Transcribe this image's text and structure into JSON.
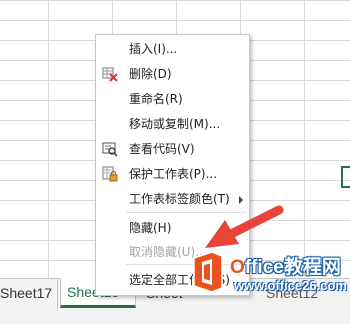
{
  "sheet_tabs": [
    {
      "label": "Sheet17",
      "active": false
    },
    {
      "label": "Sheet13",
      "active": true
    },
    {
      "label": "Sheet",
      "active": false
    },
    {
      "label": "Sheet12",
      "active": false
    }
  ],
  "context_menu": {
    "items": [
      {
        "label": "插入(I)...",
        "icon": "",
        "disabled": false
      },
      {
        "label": "删除(D)",
        "icon": "delete-sheet-icon",
        "disabled": false
      },
      {
        "label": "重命名(R)",
        "icon": "",
        "disabled": false
      },
      {
        "label": "移动或复制(M)...",
        "icon": "",
        "disabled": false
      },
      {
        "label": "查看代码(V)",
        "icon": "view-code-icon",
        "disabled": false
      },
      {
        "label": "保护工作表(P)...",
        "icon": "protect-sheet-icon",
        "disabled": false
      },
      {
        "label": "工作表标签颜色(T)",
        "icon": "",
        "disabled": false,
        "submenu": true
      },
      {
        "label": "隐藏(H)",
        "icon": "",
        "disabled": false
      },
      {
        "label": "取消隐藏(U)...",
        "icon": "",
        "disabled": true
      },
      {
        "label": "选定全部工作表(S)",
        "icon": "",
        "disabled": false
      }
    ]
  },
  "watermark": {
    "title_prefix": "O",
    "title_rest": "ffice教程网",
    "url": "www.office26.com"
  },
  "colors": {
    "excel_green": "#217346",
    "arrow_red": "#e8443a",
    "office_orange": "#e9541e",
    "watermark_blue": "#1a5fa8"
  }
}
